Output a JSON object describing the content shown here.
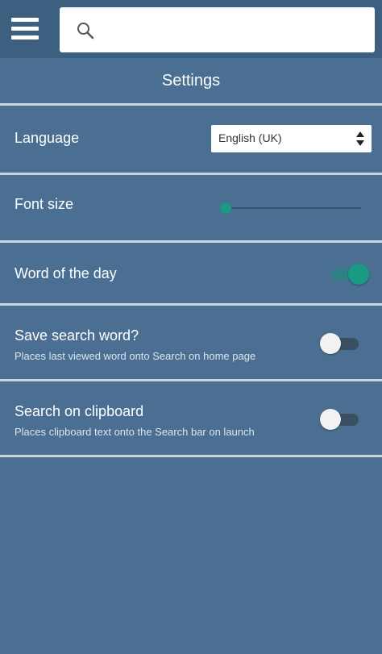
{
  "header": {
    "menu_icon": "hamburger-menu-icon",
    "search_icon": "search-icon",
    "search_value": "",
    "search_placeholder": ""
  },
  "page": {
    "title": "Settings"
  },
  "settings": {
    "language": {
      "label": "Language",
      "selected": "English (UK)"
    },
    "font_size": {
      "label": "Font size",
      "level": 0.0
    },
    "word_of_the_day": {
      "label": "Word of the day",
      "enabled": true
    },
    "save_search_word": {
      "label": "Save search word?",
      "description": "Places last viewed word onto Search on home page",
      "enabled": false
    },
    "search_on_clipboard": {
      "label": "Search on clipboard",
      "description": "Places clipboard text onto the Search bar on launch",
      "enabled": false
    }
  },
  "colors": {
    "background": "#4a6f92",
    "header": "#3d5f80",
    "accent": "#1a9a82",
    "divider": "#c8d6e2"
  }
}
